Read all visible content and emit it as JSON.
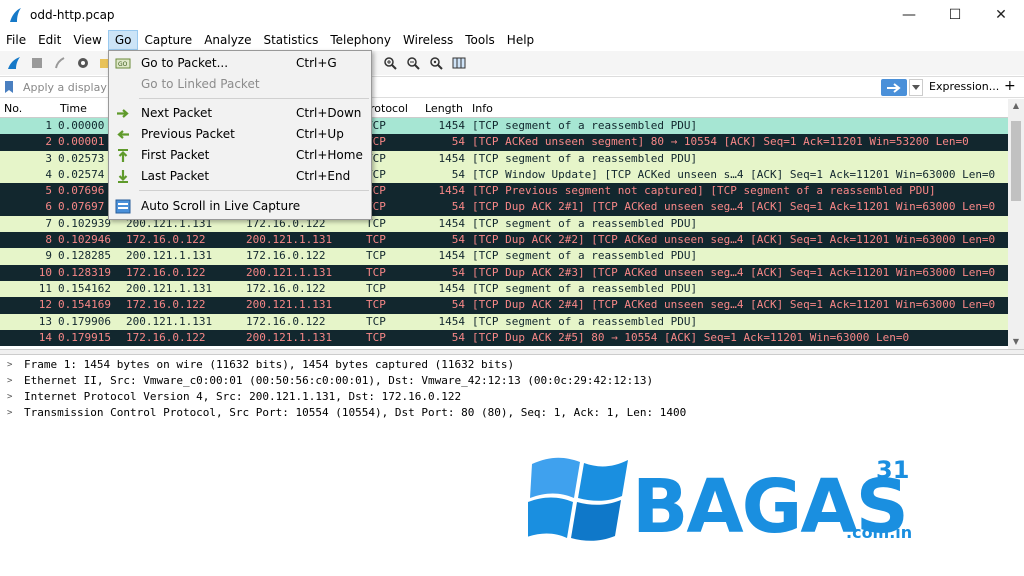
{
  "window": {
    "title": "odd-http.pcap",
    "minimize": "—",
    "maximize": "☐",
    "close": "✕"
  },
  "menu": [
    "File",
    "Edit",
    "View",
    "Go",
    "Capture",
    "Analyze",
    "Statistics",
    "Telephony",
    "Wireless",
    "Tools",
    "Help"
  ],
  "filter": {
    "placeholder": "Apply a display filt",
    "expression": "Expression...",
    "plus": "+"
  },
  "columns": {
    "no": "No.",
    "time": "Time",
    "protocol": "rotocol",
    "length": "Length",
    "info": "Info"
  },
  "packets": [
    {
      "no": "1",
      "time": "0.00000",
      "src": "",
      "dst": "",
      "proto": "TCP",
      "len": "1454",
      "info": "[TCP segment of a reassembled PDU]",
      "style": "sel"
    },
    {
      "no": "2",
      "time": "0.00001",
      "src": "",
      "dst": "",
      "proto": "TCP",
      "len": "54",
      "info": "[TCP ACKed unseen segment] 80 → 10554 [ACK] Seq=1 Ack=11201 Win=53200 Len=0",
      "style": "dark"
    },
    {
      "no": "3",
      "time": "0.02573",
      "src": "",
      "dst": "",
      "proto": "TCP",
      "len": "1454",
      "info": "[TCP segment of a reassembled PDU]",
      "style": "light"
    },
    {
      "no": "4",
      "time": "0.02574",
      "src": "",
      "dst": "",
      "proto": "TCP",
      "len": "54",
      "info": "[TCP Window Update] [TCP ACKed unseen s…4 [ACK] Seq=1 Ack=11201 Win=63000 Len=0",
      "style": "light"
    },
    {
      "no": "5",
      "time": "0.07696",
      "src": "",
      "dst": "",
      "proto": "TCP",
      "len": "1454",
      "info": "[TCP Previous segment not captured] [TCP segment of a reassembled PDU]",
      "style": "dark"
    },
    {
      "no": "6",
      "time": "0.07697",
      "src": "",
      "dst": "",
      "proto": "TCP",
      "len": "54",
      "info": "[TCP Dup ACK 2#1] [TCP ACKed unseen seg…4 [ACK] Seq=1 Ack=11201 Win=63000 Len=0",
      "style": "dark"
    },
    {
      "no": "7",
      "time": "0.102939",
      "src": "200.121.1.131",
      "dst": "172.16.0.122",
      "proto": "TCP",
      "len": "1454",
      "info": "[TCP segment of a reassembled PDU]",
      "style": "light"
    },
    {
      "no": "8",
      "time": "0.102946",
      "src": "172.16.0.122",
      "dst": "200.121.1.131",
      "proto": "TCP",
      "len": "54",
      "info": "[TCP Dup ACK 2#2] [TCP ACKed unseen seg…4 [ACK] Seq=1 Ack=11201 Win=63000 Len=0",
      "style": "dark"
    },
    {
      "no": "9",
      "time": "0.128285",
      "src": "200.121.1.131",
      "dst": "172.16.0.122",
      "proto": "TCP",
      "len": "1454",
      "info": "[TCP segment of a reassembled PDU]",
      "style": "light"
    },
    {
      "no": "10",
      "time": "0.128319",
      "src": "172.16.0.122",
      "dst": "200.121.1.131",
      "proto": "TCP",
      "len": "54",
      "info": "[TCP Dup ACK 2#3] [TCP ACKed unseen seg…4 [ACK] Seq=1 Ack=11201 Win=63000 Len=0",
      "style": "dark"
    },
    {
      "no": "11",
      "time": "0.154162",
      "src": "200.121.1.131",
      "dst": "172.16.0.122",
      "proto": "TCP",
      "len": "1454",
      "info": "[TCP segment of a reassembled PDU]",
      "style": "light"
    },
    {
      "no": "12",
      "time": "0.154169",
      "src": "172.16.0.122",
      "dst": "200.121.1.131",
      "proto": "TCP",
      "len": "54",
      "info": "[TCP Dup ACK 2#4] [TCP ACKed unseen seg…4 [ACK] Seq=1 Ack=11201 Win=63000 Len=0",
      "style": "dark"
    },
    {
      "no": "13",
      "time": "0.179906",
      "src": "200.121.1.131",
      "dst": "172.16.0.122",
      "proto": "TCP",
      "len": "1454",
      "info": "[TCP segment of a reassembled PDU]",
      "style": "light"
    },
    {
      "no": "14",
      "time": "0.179915",
      "src": "172.16.0.122",
      "dst": "200.121.1.131",
      "proto": "TCP",
      "len": "54",
      "info": "[TCP Dup ACK 2#5] 80 → 10554 [ACK] Seq=1 Ack=11201 Win=63000 Len=0",
      "style": "dark"
    }
  ],
  "details": [
    "Frame 1: 1454 bytes on wire (11632 bits), 1454 bytes captured (11632 bits)",
    "Ethernet II, Src: Vmware_c0:00:01 (00:50:56:c0:00:01), Dst: Vmware_42:12:13 (00:0c:29:42:12:13)",
    "Internet Protocol Version 4, Src: 200.121.1.131, Dst: 172.16.0.122",
    "Transmission Control Protocol, Src Port: 10554 (10554), Dst Port: 80 (80), Seq: 1, Ack: 1, Len: 1400"
  ],
  "go_menu": [
    {
      "label": "Go to Packet...",
      "shortcut": "Ctrl+G",
      "icon": "goto-packet-icon",
      "disabled": false
    },
    {
      "label": "Go to Linked Packet",
      "shortcut": "",
      "icon": "",
      "disabled": true
    },
    {
      "label": "Next Packet",
      "shortcut": "Ctrl+Down",
      "icon": "next-packet-icon",
      "disabled": false
    },
    {
      "label": "Previous Packet",
      "shortcut": "Ctrl+Up",
      "icon": "previous-packet-icon",
      "disabled": false
    },
    {
      "label": "First Packet",
      "shortcut": "Ctrl+Home",
      "icon": "first-packet-icon",
      "disabled": false
    },
    {
      "label": "Last Packet",
      "shortcut": "Ctrl+End",
      "icon": "last-packet-icon",
      "disabled": false
    },
    {
      "label": "Auto Scroll in Live Capture",
      "shortcut": "",
      "icon": "auto-scroll-icon",
      "disabled": false
    }
  ],
  "watermark": {
    "brand": "BAGAS",
    "superscript": "31",
    "domain": ".com.in"
  },
  "colors": {
    "row_light": "#e6f5c9",
    "row_dark": "#12272e",
    "row_dark_text": "#f78787",
    "row_selected": "#a6e6d3",
    "menu_active": "#cce4f7",
    "logo_blue": "#1a8fe0"
  }
}
